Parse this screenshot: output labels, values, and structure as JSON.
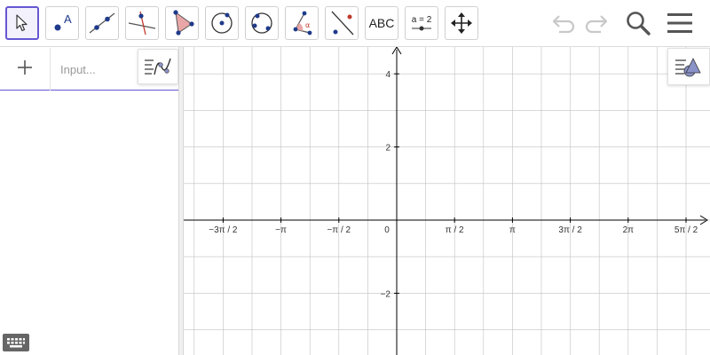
{
  "toolbar": {
    "tools": [
      {
        "name": "move-tool",
        "icon": "arrow-pointer-icon"
      },
      {
        "name": "point-tool",
        "icon": "point-icon",
        "label": "A"
      },
      {
        "name": "line-tool",
        "icon": "line-through-points-icon"
      },
      {
        "name": "perpendicular-line-tool",
        "icon": "perpendicular-line-icon"
      },
      {
        "name": "polygon-tool",
        "icon": "polygon-icon"
      },
      {
        "name": "circle-tool",
        "icon": "circle-center-point-icon"
      },
      {
        "name": "circle-three-points-tool",
        "icon": "circle-three-points-icon"
      },
      {
        "name": "angle-tool",
        "icon": "angle-icon",
        "label": "α"
      },
      {
        "name": "reflect-tool",
        "icon": "reflect-about-line-icon"
      },
      {
        "name": "text-tool",
        "icon": "text-icon",
        "label": "ABC"
      },
      {
        "name": "slider-tool",
        "icon": "slider-icon",
        "label": "a = 2"
      },
      {
        "name": "move-graphics-view-tool",
        "icon": "move-arrows-icon"
      }
    ],
    "right": [
      "undo-icon",
      "redo-icon",
      "search-icon",
      "menu-icon"
    ]
  },
  "algebra": {
    "input_placeholder": "Input..."
  },
  "graphics": {
    "x_ticks": [
      "−3π / 2",
      "−π",
      "−π / 2",
      "0",
      "π / 2",
      "π",
      "3π / 2",
      "2π",
      "5π / 2"
    ],
    "y_ticks": [
      "4",
      "2",
      "−2"
    ],
    "colors": {
      "accent": "#6557d2",
      "grid": "#c0c0c0",
      "axis": "#000000",
      "divider_blue": "#6557d2"
    }
  }
}
